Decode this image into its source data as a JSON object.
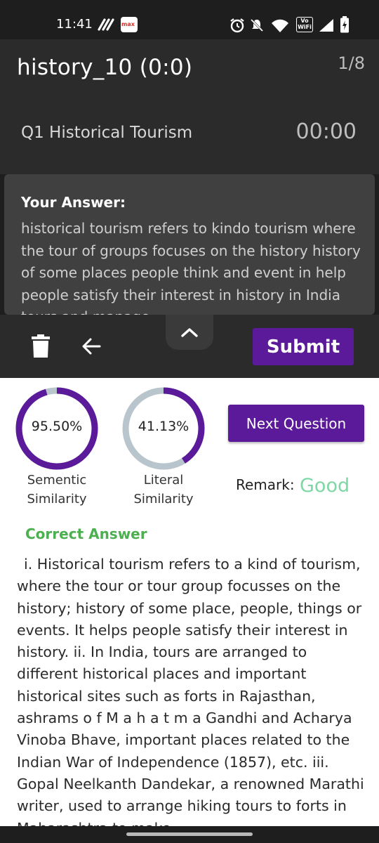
{
  "status_bar": {
    "time": "11:41",
    "app_badge": "max",
    "icons": [
      "messaging-icon",
      "app-badge-icon",
      "alarm-icon",
      "mute-icon",
      "wifi-icon",
      "vowifi-icon",
      "signal-icon",
      "battery-charging-icon"
    ],
    "vowifi_text": [
      "Vo",
      "WiFi"
    ]
  },
  "header": {
    "title": "history_10 (0:0)",
    "page_indicator": "1/8",
    "question_label": "Q1 Historical Tourism",
    "timer": "00:00"
  },
  "answer": {
    "heading": "Your Answer:",
    "text": "historical tourism refers to kindo tourism where the tour of groups focuses on the history history of some places people think and event in help people satisfy their interest in history in India tours and manage"
  },
  "toolbar": {
    "icons": [
      "trash-icon",
      "back-arrow-icon",
      "chevron-up-icon"
    ],
    "submit_label": "Submit"
  },
  "result": {
    "semantic": {
      "value": "95.50%",
      "fraction": 0.955,
      "caption": "Sementic Similarity"
    },
    "literal": {
      "value": "41.13%",
      "fraction": 0.4113,
      "caption": "Literal Similarity"
    },
    "next_label": "Next Question",
    "remark_label": "Remark:",
    "remark_value": "Good"
  },
  "correct": {
    "heading": "Correct Answer",
    "text": "i. Historical tourism refers to a kind of tourism, where the tour or tour group focusses on the history; history of some place, people, things or events. It helps people satisfy their interest in history.  ii. In India, tours are arranged to different historical places and important historical sites such as forts in Rajasthan, ashrams  o f  M a h a t m a  Gandhi and Acharya Vinoba Bhave, important places related to the Indian War of Independence (1857), etc.  iii. Gopal Neelkanth Dandekar, a renowned   Marathi writer, used to arrange hiking tours to forts in Maharashtra to make"
  },
  "colors": {
    "accent": "#5b1a99",
    "ring_track": "#b8c5cc",
    "correct_green": "#4caf50",
    "remark_green": "#7fd7a6"
  }
}
